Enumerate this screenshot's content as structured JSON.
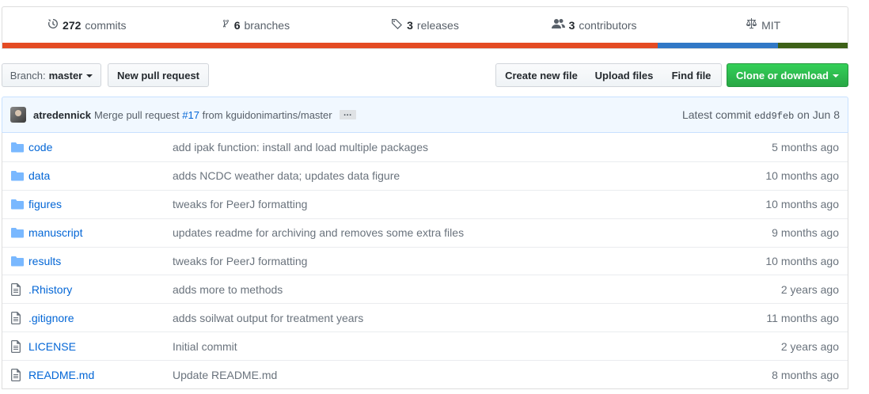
{
  "summary": {
    "commits": {
      "num": "272",
      "label": "commits"
    },
    "branches": {
      "num": "6",
      "label": "branches"
    },
    "releases": {
      "num": "3",
      "label": "releases"
    },
    "contributors": {
      "num": "3",
      "label": "contributors"
    },
    "license": {
      "label": "MIT"
    }
  },
  "language_bar": [
    {
      "color": "#e44b23",
      "fraction": 0.775
    },
    {
      "color": "#3178c6",
      "fraction": 0.143
    },
    {
      "color": "#3d6117",
      "fraction": 0.076
    }
  ],
  "toolbar": {
    "branch_prefix": "Branch:",
    "branch_name": "master",
    "new_pr": "New pull request",
    "create_file": "Create new file",
    "upload_files": "Upload files",
    "find_file": "Find file",
    "clone": "Clone or download"
  },
  "commit": {
    "author": "atredennick",
    "msg_prefix": "Merge pull request",
    "pr_link": "#17",
    "msg_suffix": "from kguidonimartins/master",
    "ellipsis": "…",
    "latest_label": "Latest commit",
    "sha": "edd9feb",
    "date": "on Jun 8"
  },
  "files": [
    {
      "type": "folder",
      "name": "code",
      "message": "add ipak function: install and load multiple packages",
      "age": "5 months ago"
    },
    {
      "type": "folder",
      "name": "data",
      "message": "adds NCDC weather data; updates data figure",
      "age": "10 months ago"
    },
    {
      "type": "folder",
      "name": "figures",
      "message": "tweaks for PeerJ formatting",
      "age": "10 months ago"
    },
    {
      "type": "folder",
      "name": "manuscript",
      "message": "updates readme for archiving and removes some extra files",
      "age": "9 months ago"
    },
    {
      "type": "folder",
      "name": "results",
      "message": "tweaks for PeerJ formatting",
      "age": "10 months ago"
    },
    {
      "type": "file",
      "name": ".Rhistory",
      "message": "adds more to methods",
      "age": "2 years ago"
    },
    {
      "type": "file",
      "name": ".gitignore",
      "message": "adds soilwat output for treatment years",
      "age": "11 months ago"
    },
    {
      "type": "file",
      "name": "LICENSE",
      "message": "Initial commit",
      "age": "2 years ago"
    },
    {
      "type": "file",
      "name": "README.md",
      "message": "Update README.md",
      "age": "8 months ago"
    }
  ]
}
